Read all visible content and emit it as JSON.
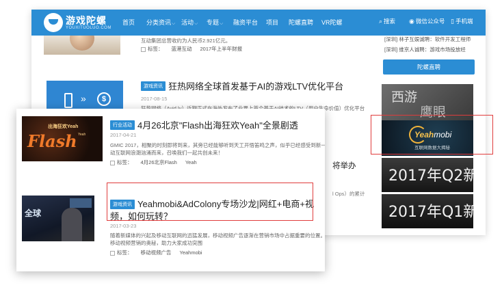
{
  "nav": {
    "logo_text": "游戏陀螺",
    "logo_sub": "YOUXITUOLUO.COM",
    "items": [
      {
        "label": "首页",
        "caret": false
      },
      {
        "label": "分类资讯",
        "caret": true
      },
      {
        "label": "活动",
        "caret": true
      },
      {
        "label": "专题",
        "caret": true
      },
      {
        "label": "融资平台",
        "caret": false
      },
      {
        "label": "项目",
        "caret": false
      },
      {
        "label": "陀螺直聘",
        "caret": false
      },
      {
        "label": "VR陀螺",
        "caret": false
      }
    ],
    "search": "搜索",
    "wechat": "微信公众号",
    "mobile": "手机端",
    "icons": {
      "search": "search-icon",
      "wechat": "wechat-icon",
      "mobile": "mobile-icon"
    }
  },
  "back_page": {
    "article1_excerpt": "互动集团总营收约为人民币2.921亿元。",
    "article1_tag_label": "标签：",
    "article1_tags": [
      "蓝港互动",
      "2017年上半年财报"
    ],
    "article2_category": "游戏资讯",
    "article2_title": "狂热网络全球首发基于AI的游戏LTV优化平台",
    "article2_date": "2017-08-15",
    "article2_excerpt": "狂热网络（Avid.ly）近期正式在海外发布了业界上首个基于AI技术的LTV（用户生命价值）优化平台",
    "fragment_title": "将举办",
    "fragment_excerpt": "l Ops）的累计",
    "sidebar_links": [
      "[深圳] 林子互娱诚聘：软件开发工程师",
      "[深圳] 维京人诚聘：游戏市场投放经"
    ],
    "sidebar_button": "陀螺直聘",
    "banner1": [
      "西游",
      "鹰眼"
    ],
    "banner2": {
      "brand": "Yeah",
      "brand2": "mobi",
      "sub": "互联网数据大揭秘"
    },
    "banner3": "2017年Q2新游",
    "banner4": "2017年Q1新游"
  },
  "front_card": {
    "article1": {
      "category": "行业活动",
      "title": "4月26北京\"Flash出海狂欢Yeah\"全景剧透",
      "date": "2017-04-21",
      "excerpt1": "GMIC 2017，相聚的时刻即将到来，其旁已经能够听到天工开悟笛鸣之声，似乎已经感受到新一波移",
      "excerpt2": "动互联网浪潮汹涌而来，召唤我们一起共创未来！",
      "tag_label": "标签：",
      "tags": [
        "4月26北京Flash",
        "Yeah"
      ],
      "thumb_title": "出海狂欢Yeah",
      "thumb_brand": "Flash"
    },
    "article2": {
      "category": "游戏资讯",
      "title": "Yeahmobi&AdColony专场沙龙|网红+电商+视频，如何玩转？",
      "date": "2017-03-23",
      "excerpt1": "随着新媒体的兴起及移动互联网的迅猛发展，移动视频广告逐渐在营销市场中占据重要的位置。为解开",
      "excerpt2": "移动视频营销的奥秘，助力大家成功突围",
      "tag_label": "标签：",
      "tags": [
        "移动视频广告",
        "Yeahmobi"
      ],
      "thumb_title": "全球"
    }
  }
}
